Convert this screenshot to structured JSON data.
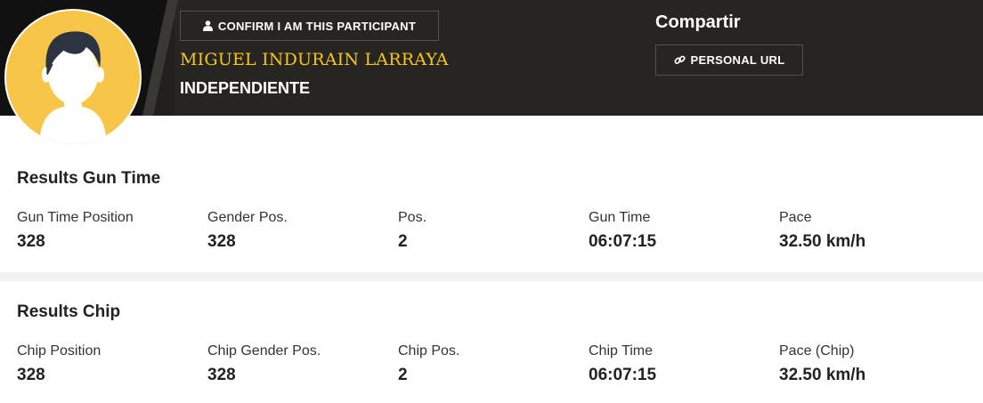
{
  "header": {
    "confirm_button_label": "CONFIRM I AM THIS PARTICIPANT",
    "participant_name": "MIGUEL INDURAIN LARRAYA",
    "team": "INDEPENDIENTE",
    "share_title": "Compartir",
    "personal_url_label": "PERSONAL URL",
    "accent_color": "#f5c518"
  },
  "gun_time": {
    "title": "Results Gun Time",
    "stats": [
      {
        "label": "Gun Time Position",
        "value": "328"
      },
      {
        "label": "Gender Pos.",
        "value": "328"
      },
      {
        "label": "Pos.",
        "value": "2"
      },
      {
        "label": "Gun Time",
        "value": "06:07:15"
      },
      {
        "label": "Pace",
        "value": "32.50 km/h"
      }
    ]
  },
  "chip": {
    "title": "Results Chip",
    "stats": [
      {
        "label": "Chip Position",
        "value": "328"
      },
      {
        "label": "Chip Gender Pos.",
        "value": "328"
      },
      {
        "label": "Chip Pos.",
        "value": "2"
      },
      {
        "label": "Chip Time",
        "value": "06:07:15"
      },
      {
        "label": "Pace (Chip)",
        "value": "32.50 km/h"
      }
    ]
  },
  "icons": {
    "avatar": "user-avatar-icon",
    "confirm": "user-icon",
    "url": "link-icon"
  }
}
